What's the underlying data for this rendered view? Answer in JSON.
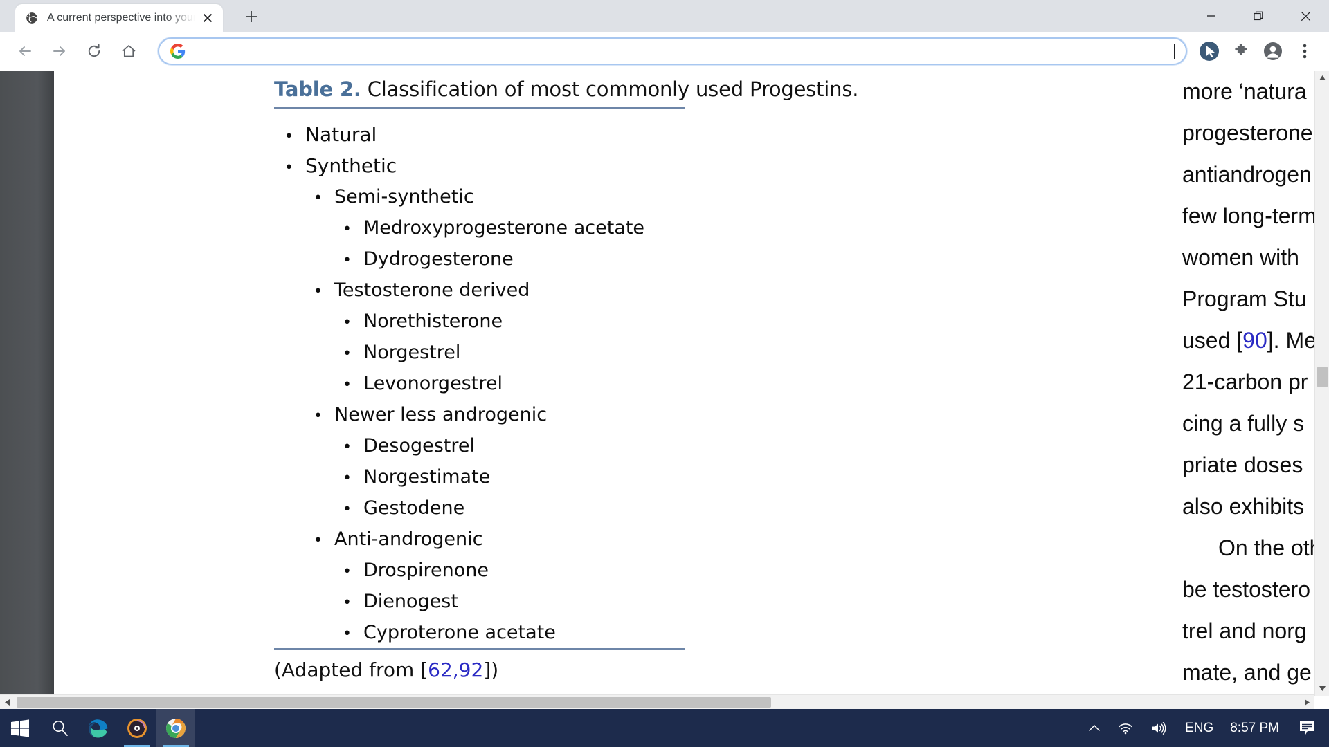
{
  "browser": {
    "tab": {
      "title": "A current perspective into young",
      "favicon_icon": "globe-icon",
      "close_icon": "close-icon"
    },
    "new_tab_icon": "plus-icon",
    "window_controls": {
      "minimize_icon": "minimize-icon",
      "maximize_icon": "maximize-icon",
      "close_icon": "close-icon"
    },
    "toolbar": {
      "back_icon": "back-arrow-icon",
      "forward_icon": "forward-arrow-icon",
      "reload_icon": "reload-icon",
      "home_icon": "home-icon",
      "omnibox": {
        "value": "",
        "placeholder": "",
        "search_engine_icon": "google-g-icon"
      },
      "cursor_tool_icon": "cursor-pointer-icon",
      "extensions_icon": "puzzle-piece-icon",
      "profile_icon": "account-avatar-icon",
      "menu_icon": "three-dot-menu-icon"
    }
  },
  "document": {
    "table": {
      "caption_number": "Table 2.",
      "caption_text": " Classification of most commonly used Progestins.",
      "items": [
        {
          "level": 0,
          "label": "Natural"
        },
        {
          "level": 0,
          "label": "Synthetic"
        },
        {
          "level": 1,
          "label": "Semi-synthetic"
        },
        {
          "level": 2,
          "label": "Medroxyprogesterone acetate"
        },
        {
          "level": 2,
          "label": "Dydrogesterone"
        },
        {
          "level": 1,
          "label": "Testosterone derived"
        },
        {
          "level": 2,
          "label": "Norethisterone"
        },
        {
          "level": 2,
          "label": "Norgestrel"
        },
        {
          "level": 2,
          "label": "Levonorgestrel"
        },
        {
          "level": 1,
          "label": "Newer less androgenic"
        },
        {
          "level": 2,
          "label": "Desogestrel"
        },
        {
          "level": 2,
          "label": "Norgestimate"
        },
        {
          "level": 2,
          "label": "Gestodene"
        },
        {
          "level": 1,
          "label": "Anti-androgenic"
        },
        {
          "level": 2,
          "label": "Drospirenone"
        },
        {
          "level": 2,
          "label": "Dienogest"
        },
        {
          "level": 2,
          "label": "Cyproterone acetate"
        }
      ],
      "source_note_prefix": "(Adapted from [",
      "source_note_citation": "62,92",
      "source_note_suffix": "])"
    },
    "right_column_lines": [
      {
        "text": "more ‘natura",
        "indent": false
      },
      {
        "text": "progesterone",
        "indent": false
      },
      {
        "text": "antiandrogen",
        "indent": false
      },
      {
        "text": "few long-term",
        "indent": false
      },
      {
        "text": "women  with",
        "indent": false
      },
      {
        "text": "Program  Stu",
        "indent": false
      },
      {
        "text": "used [",
        "indent": false,
        "cite": "90",
        "after": "]. Me"
      },
      {
        "text": "21-carbon  pr",
        "indent": false
      },
      {
        "text": "cing  a  fully  s",
        "indent": false
      },
      {
        "text": "priate  doses",
        "indent": false
      },
      {
        "text": "also exhibits",
        "indent": false
      },
      {
        "text": "On the oth",
        "indent": true
      },
      {
        "text": "be testostero",
        "indent": false
      },
      {
        "text": "trel  and  norg",
        "indent": false
      },
      {
        "text": "mate,  and  ge",
        "indent": false
      }
    ]
  },
  "scrollbars": {
    "vertical": {
      "up_icon": "scroll-up-arrow-icon",
      "down_icon": "scroll-down-arrow-icon"
    },
    "horizontal": {
      "left_icon": "scroll-left-arrow-icon",
      "right_icon": "scroll-right-arrow-icon"
    }
  },
  "taskbar": {
    "start_icon": "windows-start-icon",
    "search_icon": "search-icon",
    "apps": [
      {
        "name": "microsoft-edge",
        "icon": "edge-icon",
        "active": false
      },
      {
        "name": "media-recorder",
        "icon": "record-disc-icon",
        "active": false
      },
      {
        "name": "google-chrome",
        "icon": "chrome-icon",
        "active": true
      }
    ],
    "tray": {
      "overflow_icon": "chevron-up-icon",
      "network_icon": "wifi-icon",
      "volume_icon": "speaker-icon",
      "language": "ENG",
      "clock": "8:57 PM",
      "notifications_icon": "notification-icon"
    }
  }
}
